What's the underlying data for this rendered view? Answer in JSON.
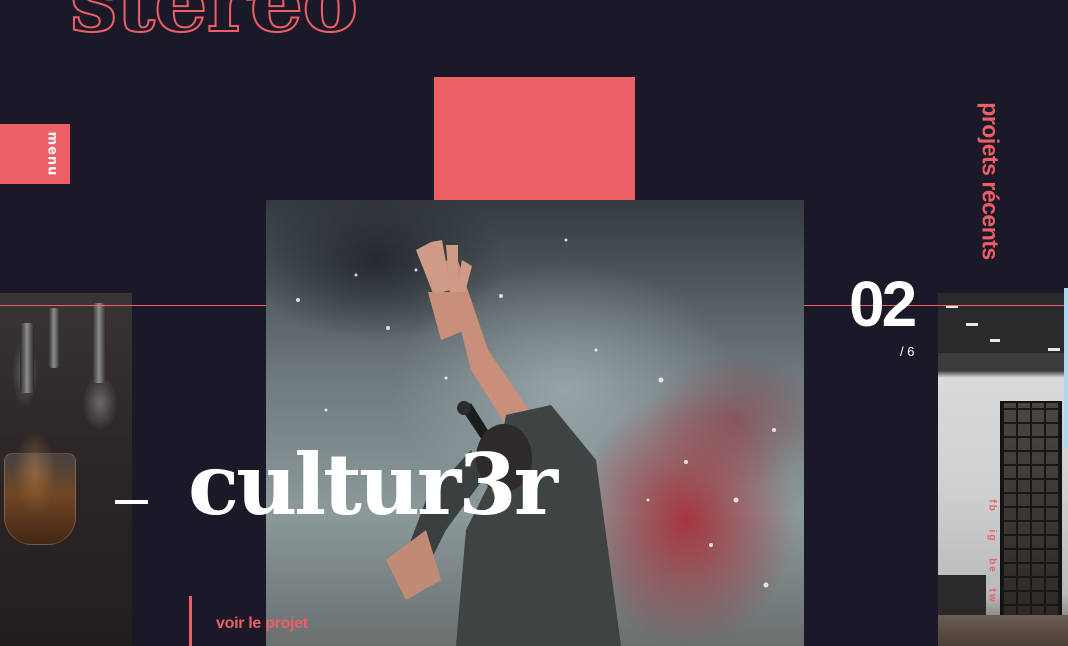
{
  "brand": {
    "logo_text": "stereo"
  },
  "nav": {
    "menu_label": "menu"
  },
  "section": {
    "label": "projets récents"
  },
  "project": {
    "title": "cultur3r",
    "view_label": "voir le projet",
    "index": "02",
    "total": "/ 6"
  },
  "social": [
    {
      "label": "fb"
    },
    {
      "label": "ig"
    },
    {
      "label": "be"
    },
    {
      "label": "tw"
    }
  ],
  "colors": {
    "background": "#1b1828",
    "accent": "#ec5f66",
    "text": "#ffffff",
    "scroll_indicator": "#a6d8f2"
  }
}
